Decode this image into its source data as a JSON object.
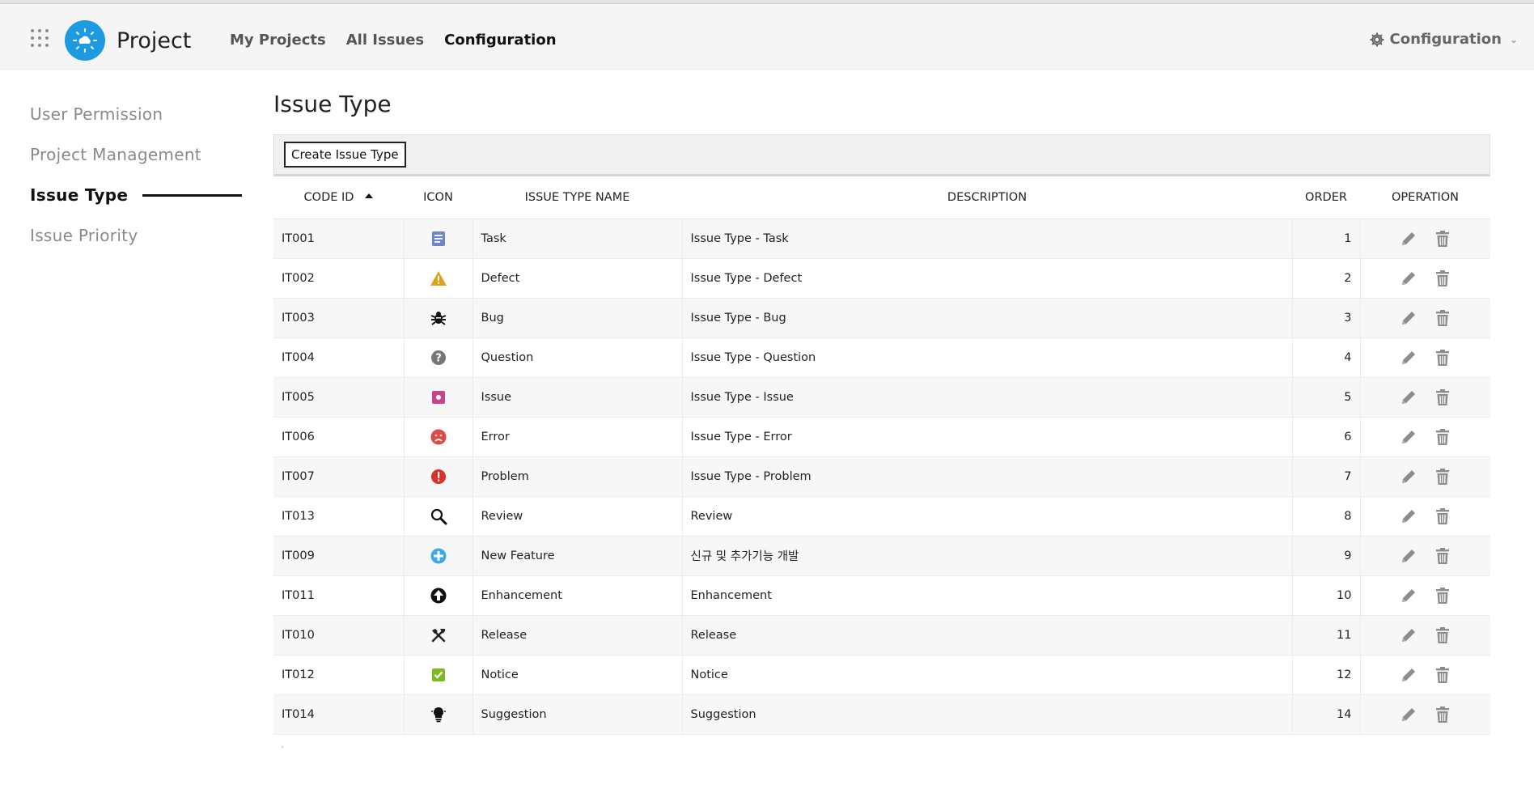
{
  "header": {
    "app_title": "Project",
    "nav": [
      "My Projects",
      "All Issues",
      "Configuration"
    ],
    "config_menu_label": "Configuration"
  },
  "sidebar": {
    "items": [
      {
        "label": "User Permission"
      },
      {
        "label": "Project Management"
      },
      {
        "label": "Issue Type"
      },
      {
        "label": "Issue Priority"
      }
    ]
  },
  "main": {
    "title": "Issue Type",
    "create_button": "Create Issue Type",
    "columns": [
      "CODE ID",
      "ICON",
      "ISSUE TYPE NAME",
      "DESCRIPTION",
      "ORDER",
      "OPERATION"
    ],
    "rows": [
      {
        "code": "IT001",
        "icon": "task-icon",
        "name": "Task",
        "description": "Issue Type - Task",
        "order": "1"
      },
      {
        "code": "IT002",
        "icon": "warning-icon",
        "name": "Defect",
        "description": "Issue Type - Defect",
        "order": "2"
      },
      {
        "code": "IT003",
        "icon": "bug-icon",
        "name": "Bug",
        "description": "Issue Type - Bug",
        "order": "3"
      },
      {
        "code": "IT004",
        "icon": "question-icon",
        "name": "Question",
        "description": "Issue Type - Question",
        "order": "4"
      },
      {
        "code": "IT005",
        "icon": "issue-icon",
        "name": "Issue",
        "description": "Issue Type - Issue",
        "order": "5"
      },
      {
        "code": "IT006",
        "icon": "sad-face-icon",
        "name": "Error",
        "description": "Issue Type - Error",
        "order": "6"
      },
      {
        "code": "IT007",
        "icon": "exclamation-icon",
        "name": "Problem",
        "description": "Issue Type - Problem",
        "order": "7"
      },
      {
        "code": "IT013",
        "icon": "magnifier-icon",
        "name": "Review",
        "description": "Review",
        "order": "8"
      },
      {
        "code": "IT009",
        "icon": "plus-circle-icon",
        "name": "New Feature",
        "description": "신규 및 추가기능 개발",
        "order": "9"
      },
      {
        "code": "IT011",
        "icon": "arrow-up-circle-icon",
        "name": "Enhancement",
        "description": "Enhancement",
        "order": "10"
      },
      {
        "code": "IT010",
        "icon": "tools-icon",
        "name": "Release",
        "description": "Release",
        "order": "11"
      },
      {
        "code": "IT012",
        "icon": "checkbox-icon",
        "name": "Notice",
        "description": "Notice",
        "order": "12"
      },
      {
        "code": "IT014",
        "icon": "lightbulb-icon",
        "name": "Suggestion",
        "description": "Suggestion",
        "order": "14"
      }
    ]
  },
  "colors": {
    "brand": "#1e9be0",
    "task": "#6f86c7",
    "warning": "#d8a51c",
    "issue": "#c8458b",
    "error": "#e04848",
    "problem": "#d9312d",
    "new_feature": "#3fa9e8",
    "notice": "#7cba24"
  }
}
